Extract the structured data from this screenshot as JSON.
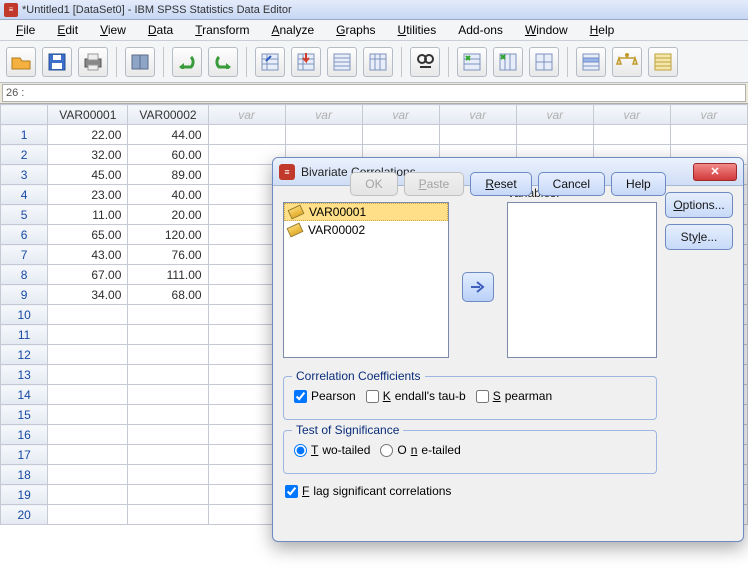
{
  "window": {
    "title": "*Untitled1 [DataSet0] - IBM SPSS Statistics Data Editor"
  },
  "menu": {
    "file": "File",
    "edit": "Edit",
    "view": "View",
    "data": "Data",
    "transform": "Transform",
    "analyze": "Analyze",
    "graphs": "Graphs",
    "utilities": "Utilities",
    "addons": "Add-ons",
    "window": "Window",
    "help": "Help"
  },
  "cell_address": "26 :",
  "columns": {
    "var1": "VAR00001",
    "var2": "VAR00002",
    "empty": "var"
  },
  "rows": [
    {
      "n": "1",
      "v1": "22.00",
      "v2": "44.00"
    },
    {
      "n": "2",
      "v1": "32.00",
      "v2": "60.00"
    },
    {
      "n": "3",
      "v1": "45.00",
      "v2": "89.00"
    },
    {
      "n": "4",
      "v1": "23.00",
      "v2": "40.00"
    },
    {
      "n": "5",
      "v1": "11.00",
      "v2": "20.00"
    },
    {
      "n": "6",
      "v1": "65.00",
      "v2": "120.00"
    },
    {
      "n": "7",
      "v1": "43.00",
      "v2": "76.00"
    },
    {
      "n": "8",
      "v1": "67.00",
      "v2": "111.00"
    },
    {
      "n": "9",
      "v1": "34.00",
      "v2": "68.00"
    },
    {
      "n": "10",
      "v1": "",
      "v2": ""
    },
    {
      "n": "11",
      "v1": "",
      "v2": ""
    },
    {
      "n": "12",
      "v1": "",
      "v2": ""
    },
    {
      "n": "13",
      "v1": "",
      "v2": ""
    },
    {
      "n": "14",
      "v1": "",
      "v2": ""
    },
    {
      "n": "15",
      "v1": "",
      "v2": ""
    },
    {
      "n": "16",
      "v1": "",
      "v2": ""
    },
    {
      "n": "17",
      "v1": "",
      "v2": ""
    },
    {
      "n": "18",
      "v1": "",
      "v2": ""
    },
    {
      "n": "19",
      "v1": "",
      "v2": ""
    },
    {
      "n": "20",
      "v1": "",
      "v2": ""
    }
  ],
  "dialog": {
    "title": "Bivariate Correlations",
    "variables_label": "Variables:",
    "options_btn": "Options...",
    "style_btn": "Style...",
    "source_items": [
      "VAR00001",
      "VAR00002"
    ],
    "coeff_legend": "Correlation Coefficients",
    "pearson": "Pearson",
    "kendall": "Kendall's tau-b",
    "spearman": "Spearman",
    "sig_legend": "Test of Significance",
    "two_tailed": "Two-tailed",
    "one_tailed": "One-tailed",
    "flag": "Flag significant correlations",
    "ok": "OK",
    "paste": "Paste",
    "reset": "Reset",
    "cancel": "Cancel",
    "help": "Help"
  }
}
